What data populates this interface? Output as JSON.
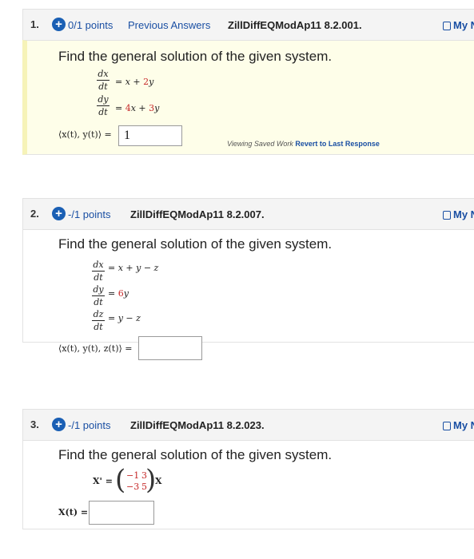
{
  "questions": [
    {
      "number": "1.",
      "points": "0/1 points",
      "previous_answers": "Previous Answers",
      "code": "ZillDiffEQModAp11 8.2.001.",
      "my_notes": "My N",
      "prompt": "Find the general solution of the given system.",
      "eq1": {
        "num": "dx",
        "den": "dt",
        "rhs": [
          "= ",
          "x",
          " + ",
          "2",
          "y"
        ]
      },
      "eq2": {
        "num": "dy",
        "den": "dt",
        "rhs": [
          "= ",
          "4",
          "x",
          " + ",
          "3",
          "y"
        ]
      },
      "answer_label": "⟨x(t), y(t)⟩ =",
      "answer_value": "1",
      "status": "Viewing Saved Work",
      "revert": "Revert to Last Response"
    },
    {
      "number": "2.",
      "points": "-/1 points",
      "code": "ZillDiffEQModAp11 8.2.007.",
      "my_notes": "My N",
      "prompt": "Find the general solution of the given system.",
      "eq1": {
        "num": "dx",
        "den": "dt",
        "rhs": "= x + y − z"
      },
      "eq2": {
        "num": "dy",
        "den": "dt",
        "rhs_pre": "= ",
        "rhs_c": "6",
        "rhs_v": "y"
      },
      "eq3": {
        "num": "dz",
        "den": "dt",
        "rhs": "= y − z"
      },
      "answer_label": "⟨x(t), y(t), z(t)⟩ =",
      "answer_value": ""
    },
    {
      "number": "3.",
      "points": "-/1 points",
      "code": "ZillDiffEQModAp11 8.2.023.",
      "my_notes": "My N",
      "prompt": "Find the general solution of the given system.",
      "lhs": "X' =",
      "matrix": [
        [
          "−1",
          "3"
        ],
        [
          "−3",
          "5"
        ]
      ],
      "rhs": "X",
      "answer_label": "X(t) =",
      "answer_value": ""
    }
  ],
  "colors": {
    "link": "#1a4fa3",
    "accent_icon": "#1a5fb4",
    "coef": "#c62828",
    "highlight": "#fefee9"
  }
}
